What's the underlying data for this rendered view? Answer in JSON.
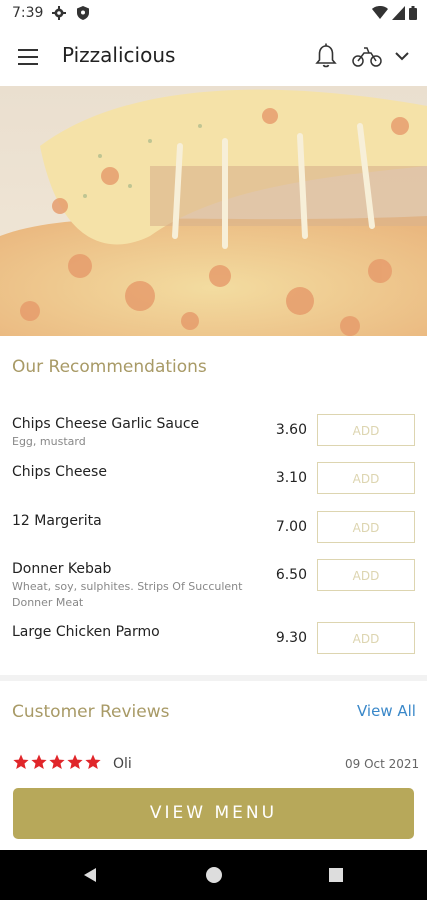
{
  "status_bar": {
    "time": "7:39"
  },
  "app_bar": {
    "title": "Pizzalicious"
  },
  "recommendations": {
    "title": "Our Recommendations",
    "items": [
      {
        "name": "Chips Cheese Garlic Sauce",
        "description": "Egg, mustard",
        "price": "3.60",
        "action": "ADD"
      },
      {
        "name": "Chips Cheese",
        "description": "",
        "price": "3.10",
        "action": "ADD"
      },
      {
        "name": "12 Margerita",
        "description": "",
        "price": "7.00",
        "action": "ADD"
      },
      {
        "name": "Donner Kebab",
        "description": "Wheat, soy, sulphites. Strips Of Succulent Donner Meat",
        "price": "6.50",
        "action": "ADD"
      },
      {
        "name": "Large Chicken Parmo",
        "description": "",
        "price": "9.30",
        "action": "ADD"
      }
    ]
  },
  "reviews": {
    "title": "Customer Reviews",
    "view_all": "View All",
    "entries": [
      {
        "rating": 5,
        "author": "Oli",
        "date": "09 Oct 2021"
      }
    ]
  },
  "view_menu_button": "VIEW MENU",
  "colors": {
    "accent": "#b7a85a",
    "section_title": "#a89a66",
    "link": "#3a88c9",
    "star": "#e0262a"
  }
}
